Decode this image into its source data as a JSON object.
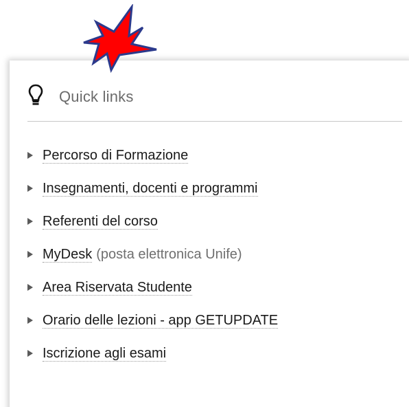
{
  "panel": {
    "title": "Quick links",
    "icon": "lightbulb-icon"
  },
  "links": [
    {
      "label": "Percorso di Formazione",
      "note": ""
    },
    {
      "label": "Insegnamenti, docenti e programmi",
      "note": ""
    },
    {
      "label": "Referenti del corso",
      "note": ""
    },
    {
      "label": "MyDesk",
      "note": "(posta elettronica Unife)"
    },
    {
      "label": "Area Riservata Studente",
      "note": ""
    },
    {
      "label": "Orario delle lezioni - app GETUPDATE",
      "note": ""
    },
    {
      "label": "Iscrizione agli esami",
      "note": ""
    }
  ],
  "colors": {
    "arrow_fill": "#ff0000",
    "arrow_stroke": "#2b3a8c",
    "title": "#6b6b6b",
    "link": "#1a1a1a",
    "note": "#6f6f6f"
  }
}
